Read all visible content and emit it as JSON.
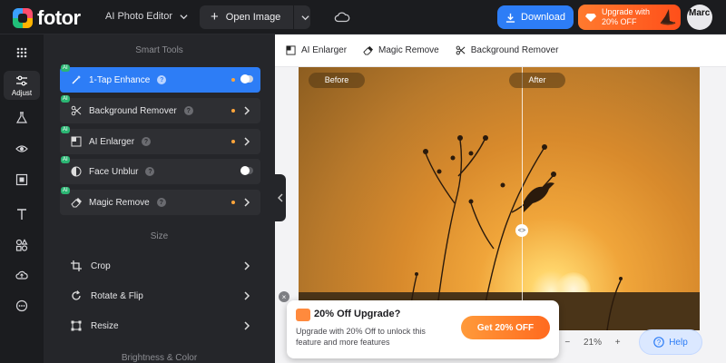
{
  "header": {
    "logo_text": "fotor",
    "product_menu": "AI Photo Editor",
    "open_image": "Open Image",
    "download": "Download",
    "upgrade_line1": "Upgrade with",
    "upgrade_line2": "20% OFF",
    "avatar_text": "Marc"
  },
  "rail": {
    "active_label": "Adjust"
  },
  "panel": {
    "smart_tools_title": "Smart Tools",
    "size_title": "Size",
    "brightness_title": "Brightness & Color",
    "ai_tag": "AI",
    "smart_tools": [
      {
        "label": "1-Tap Enhance",
        "toggle": "on"
      },
      {
        "label": "Background Remover"
      },
      {
        "label": "AI Enlarger"
      },
      {
        "label": "Face Unblur",
        "toggle": "off"
      },
      {
        "label": "Magic Remove"
      }
    ],
    "size_tools": [
      {
        "label": "Crop"
      },
      {
        "label": "Rotate & Flip"
      },
      {
        "label": "Resize"
      }
    ]
  },
  "canvas": {
    "toolbar": [
      "AI Enlarger",
      "Magic Remove",
      "Background Remover"
    ],
    "before_label": "Before",
    "after_label": "After",
    "zoom_value": "21%",
    "help": "Help"
  },
  "promo": {
    "title": "20% Off Upgrade?",
    "text": "Upgrade with 20% Off to unlock this feature and more features",
    "cta": "Get 20% OFF"
  },
  "colors": {
    "accent": "#2d7df6",
    "promo_orange": "#ff6a1f",
    "panel_bg": "#25262a"
  }
}
